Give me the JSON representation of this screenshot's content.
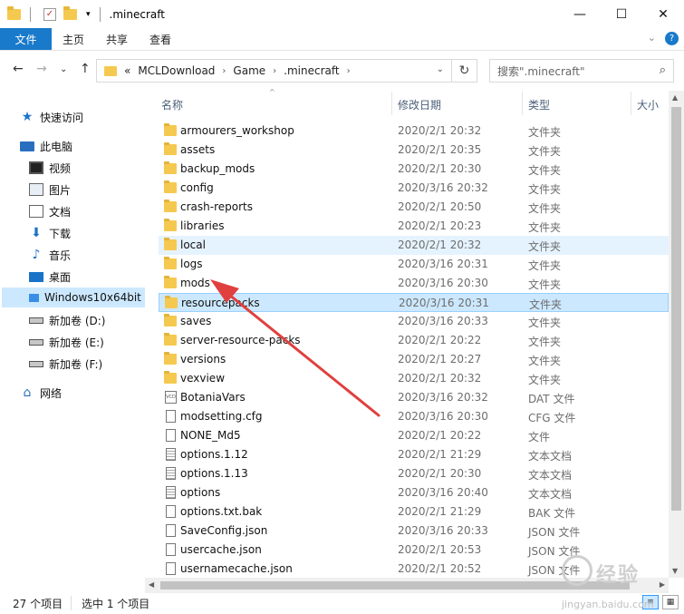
{
  "window": {
    "title": ".minecraft",
    "minimize_glyph": "—",
    "maximize_glyph": "☐",
    "close_glyph": "✕"
  },
  "ribbon": {
    "tabs": [
      "文件",
      "主页",
      "共享",
      "查看"
    ],
    "expand_glyph": "⌄",
    "help_glyph": "?"
  },
  "address": {
    "back_glyph": "←",
    "forward_glyph": "→",
    "recent_glyph": "⌄",
    "up_glyph": "↑",
    "overflow": "«",
    "crumbs": [
      "MCLDownload",
      "Game",
      ".minecraft"
    ],
    "separator": "›",
    "dropdown_glyph": "⌄",
    "refresh_glyph": "↻"
  },
  "search": {
    "placeholder": "搜索\".minecraft\"",
    "icon": "search-icon"
  },
  "sidebar": {
    "items": [
      {
        "label": "快速访问",
        "icon": "star-icon"
      },
      {
        "label": "此电脑",
        "icon": "computer-icon"
      },
      {
        "label": "视频",
        "icon": "video-icon"
      },
      {
        "label": "图片",
        "icon": "pictures-icon"
      },
      {
        "label": "文档",
        "icon": "documents-icon"
      },
      {
        "label": "下载",
        "icon": "download-icon"
      },
      {
        "label": "音乐",
        "icon": "music-icon"
      },
      {
        "label": "桌面",
        "icon": "desktop-icon"
      },
      {
        "label": "Windows10x64bit",
        "icon": "windows-drive-icon"
      },
      {
        "label": "新加卷 (D:)",
        "icon": "drive-icon"
      },
      {
        "label": "新加卷 (E:)",
        "icon": "drive-icon"
      },
      {
        "label": "新加卷 (F:)",
        "icon": "drive-icon"
      },
      {
        "label": "网络",
        "icon": "network-icon"
      }
    ]
  },
  "columns": {
    "name": "名称",
    "date": "修改日期",
    "type": "类型",
    "size": "大小"
  },
  "files": [
    {
      "name": "armourers_workshop",
      "date": "2020/2/1 20:32",
      "type": "文件夹",
      "kind": "folder"
    },
    {
      "name": "assets",
      "date": "2020/2/1 20:35",
      "type": "文件夹",
      "kind": "folder"
    },
    {
      "name": "backup_mods",
      "date": "2020/2/1 20:30",
      "type": "文件夹",
      "kind": "folder"
    },
    {
      "name": "config",
      "date": "2020/3/16 20:32",
      "type": "文件夹",
      "kind": "folder"
    },
    {
      "name": "crash-reports",
      "date": "2020/2/1 20:50",
      "type": "文件夹",
      "kind": "folder"
    },
    {
      "name": "libraries",
      "date": "2020/2/1 20:23",
      "type": "文件夹",
      "kind": "folder"
    },
    {
      "name": "local",
      "date": "2020/2/1 20:32",
      "type": "文件夹",
      "kind": "folder"
    },
    {
      "name": "logs",
      "date": "2020/3/16 20:31",
      "type": "文件夹",
      "kind": "folder"
    },
    {
      "name": "mods",
      "date": "2020/3/16 20:30",
      "type": "文件夹",
      "kind": "folder"
    },
    {
      "name": "resourcepacks",
      "date": "2020/3/16 20:31",
      "type": "文件夹",
      "kind": "folder"
    },
    {
      "name": "saves",
      "date": "2020/3/16 20:33",
      "type": "文件夹",
      "kind": "folder"
    },
    {
      "name": "server-resource-packs",
      "date": "2020/2/1 20:22",
      "type": "文件夹",
      "kind": "folder"
    },
    {
      "name": "versions",
      "date": "2020/2/1 20:27",
      "type": "文件夹",
      "kind": "folder"
    },
    {
      "name": "vexview",
      "date": "2020/2/1 20:32",
      "type": "文件夹",
      "kind": "folder"
    },
    {
      "name": "BotaniaVars",
      "date": "2020/3/16 20:32",
      "type": "DAT 文件",
      "kind": "vcd"
    },
    {
      "name": "modsetting.cfg",
      "date": "2020/3/16 20:30",
      "type": "CFG 文件",
      "kind": "file"
    },
    {
      "name": "NONE_Md5",
      "date": "2020/2/1 20:22",
      "type": "文件",
      "kind": "file"
    },
    {
      "name": "options.1.12",
      "date": "2020/2/1 21:29",
      "type": "文本文档",
      "kind": "text"
    },
    {
      "name": "options.1.13",
      "date": "2020/2/1 20:30",
      "type": "文本文档",
      "kind": "text"
    },
    {
      "name": "options",
      "date": "2020/3/16 20:40",
      "type": "文本文档",
      "kind": "text"
    },
    {
      "name": "options.txt.bak",
      "date": "2020/2/1 21:29",
      "type": "BAK 文件",
      "kind": "file"
    },
    {
      "name": "SaveConfig.json",
      "date": "2020/3/16 20:33",
      "type": "JSON 文件",
      "kind": "file"
    },
    {
      "name": "usercache.json",
      "date": "2020/2/1 20:53",
      "type": "JSON 文件",
      "kind": "file"
    },
    {
      "name": "usernamecache.json",
      "date": "2020/2/1 20:52",
      "type": "JSON 文件",
      "kind": "file"
    }
  ],
  "state": {
    "hover_row": "local",
    "selected_row": "resourcepacks",
    "selected_sidebar": "Windows10x64bit"
  },
  "status": {
    "count": "27 个项目",
    "selected": "选中 1 个项目"
  },
  "annotation": {
    "arrow_color": "#e0403e",
    "points_to": "mods"
  },
  "watermark": {
    "text": "经验",
    "url": "jingyan.baidu.com"
  },
  "colors": {
    "accent": "#1979ca",
    "selection": "#cce8ff",
    "hover": "#e5f3ff",
    "folder": "#f5c94f"
  }
}
